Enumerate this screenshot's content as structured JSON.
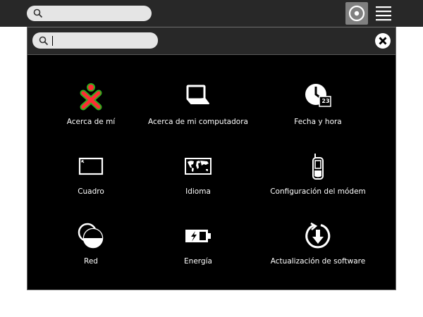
{
  "toolbar": {
    "search": {
      "value": "",
      "placeholder": ""
    },
    "view_icon": "neighborhood-view-icon",
    "list_icon": "list-view-icon"
  },
  "panel": {
    "search": {
      "value": "",
      "placeholder": ""
    },
    "close_icon": "close-icon",
    "items": [
      {
        "label": "Acerca de mí",
        "icon": "xo-icon"
      },
      {
        "label": "Acerca de mi computadora",
        "icon": "computer-icon"
      },
      {
        "label": "Fecha y hora",
        "icon": "clock-icon",
        "icon_text": "23"
      },
      {
        "label": "Cuadro",
        "icon": "frame-icon"
      },
      {
        "label": "Idioma",
        "icon": "world-map-icon"
      },
      {
        "label": "Configuración del módem",
        "icon": "cellphone-icon"
      },
      {
        "label": "Red",
        "icon": "network-icon"
      },
      {
        "label": "Energía",
        "icon": "battery-icon"
      },
      {
        "label": "Actualización de software",
        "icon": "update-icon"
      }
    ]
  },
  "colors": {
    "toolbar_bg": "#282828",
    "panel_bg": "#000000",
    "xo_stroke": "#2fae1d",
    "xo_fill": "#ff2b34"
  }
}
